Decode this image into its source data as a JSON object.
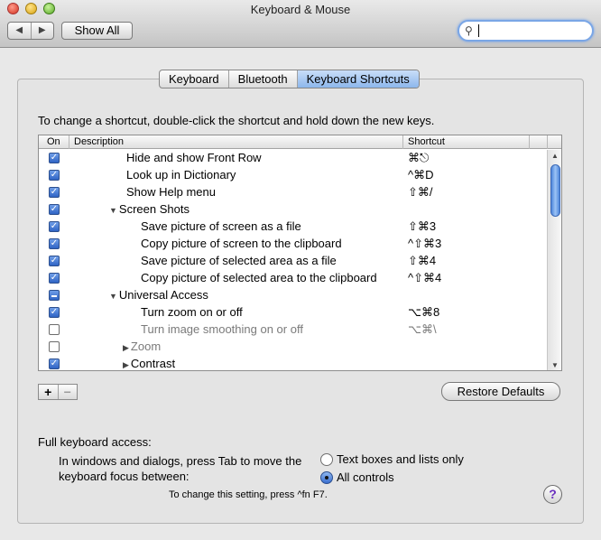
{
  "window": {
    "title": "Keyboard & Mouse",
    "show_all": "Show All",
    "nav_back": "◀",
    "nav_forward": "▶",
    "search_placeholder": ""
  },
  "tabs": [
    {
      "label": "Keyboard",
      "active": false
    },
    {
      "label": "Bluetooth",
      "active": false
    },
    {
      "label": "Keyboard Shortcuts",
      "active": true
    }
  ],
  "instruction": "To change a shortcut, double-click the shortcut and hold down the new keys.",
  "table": {
    "headers": {
      "on": "On",
      "description": "Description",
      "shortcut": "Shortcut"
    },
    "rows": [
      {
        "state": "on",
        "indent": 1,
        "disclosure": "",
        "label": "Hide and show Front Row",
        "shortcut": "⌘⎋",
        "dim": false
      },
      {
        "state": "on",
        "indent": 1,
        "disclosure": "",
        "label": "Look up in Dictionary",
        "shortcut": "^⌘D",
        "dim": false
      },
      {
        "state": "on",
        "indent": 1,
        "disclosure": "",
        "label": "Show Help menu",
        "shortcut": "⇧⌘/",
        "dim": false
      },
      {
        "state": "on",
        "indent": 0,
        "disclosure": "▼",
        "label": "Screen Shots",
        "shortcut": "",
        "dim": false
      },
      {
        "state": "on",
        "indent": 2,
        "disclosure": "",
        "label": "Save picture of screen as a file",
        "shortcut": "⇧⌘3",
        "dim": false
      },
      {
        "state": "on",
        "indent": 2,
        "disclosure": "",
        "label": "Copy picture of screen to the clipboard",
        "shortcut": "^⇧⌘3",
        "dim": false
      },
      {
        "state": "on",
        "indent": 2,
        "disclosure": "",
        "label": "Save picture of selected area as a file",
        "shortcut": "⇧⌘4",
        "dim": false
      },
      {
        "state": "on",
        "indent": 2,
        "disclosure": "",
        "label": "Copy picture of selected area to the clipboard",
        "shortcut": "^⇧⌘4",
        "dim": false
      },
      {
        "state": "mixed",
        "indent": 0,
        "disclosure": "▼",
        "label": "Universal Access",
        "shortcut": "",
        "dim": false
      },
      {
        "state": "on",
        "indent": 2,
        "disclosure": "",
        "label": "Turn zoom on or off",
        "shortcut": "⌥⌘8",
        "dim": false
      },
      {
        "state": "off",
        "indent": 2,
        "disclosure": "",
        "label": "Turn image smoothing on or off",
        "shortcut": "⌥⌘\\",
        "dim": true
      },
      {
        "state": "off",
        "indent": 3,
        "disclosure": "▶",
        "label": "Zoom",
        "shortcut": "",
        "dim": true
      },
      {
        "state": "on",
        "indent": 3,
        "disclosure": "▶",
        "label": "Contrast",
        "shortcut": "",
        "dim": false
      }
    ]
  },
  "buttons": {
    "add": "+",
    "remove": "−",
    "restore": "Restore Defaults",
    "help": "?"
  },
  "keyboard_access": {
    "label": "Full keyboard access:",
    "description": "In windows and dialogs, press Tab to move the keyboard focus between:",
    "options": [
      {
        "label": "Text boxes and lists only",
        "selected": false
      },
      {
        "label": "All controls",
        "selected": true
      }
    ],
    "note": "To change this setting, press ^fn F7."
  }
}
